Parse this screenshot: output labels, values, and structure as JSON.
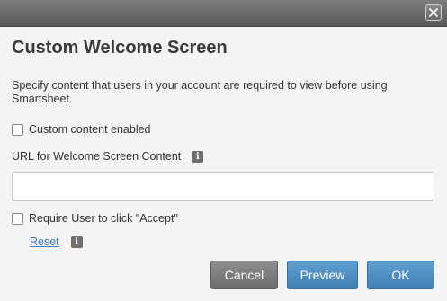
{
  "dialog": {
    "title": "Custom Welcome Screen",
    "description": "Specify content that users in your account are required to view before using Smartsheet.",
    "custom_content_label": "Custom content enabled",
    "custom_content_checked": false,
    "url_label": "URL for Welcome Screen Content",
    "url_value": "",
    "info_glyph": "i",
    "require_accept_label": "Require User to click \"Accept\"",
    "require_accept_checked": false,
    "reset_label": "Reset",
    "buttons": {
      "cancel": "Cancel",
      "preview": "Preview",
      "ok": "OK"
    }
  },
  "icons": {
    "close": "close-icon",
    "info": "info-icon"
  },
  "colors": {
    "titlebar": "#666666",
    "background": "#f4f4f4",
    "primary_button": "#4a8bc2",
    "secondary_button": "#7c7c7c",
    "link": "#3d7ab5"
  }
}
